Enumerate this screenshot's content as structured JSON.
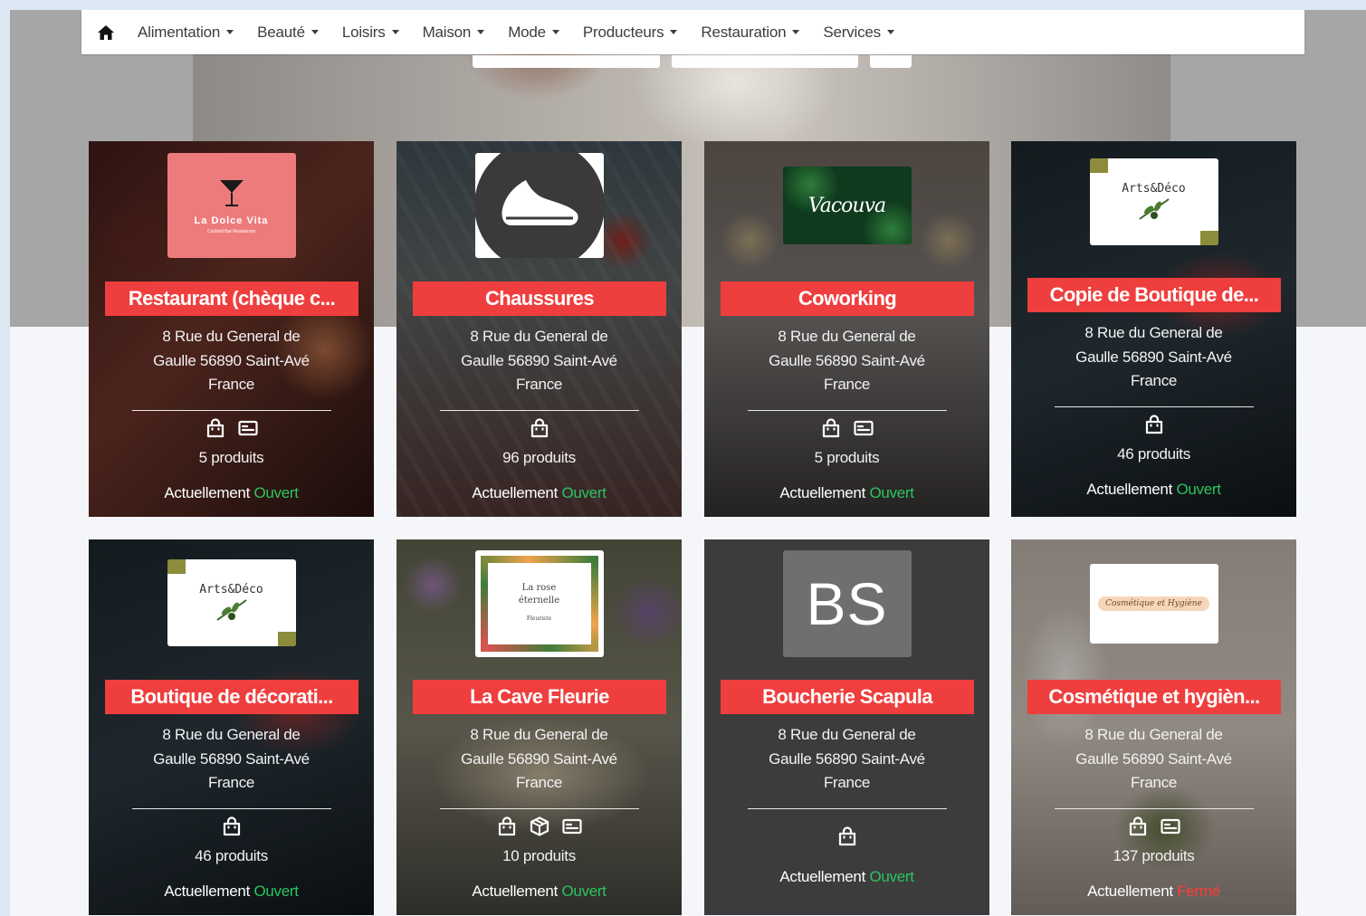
{
  "nav": {
    "items": [
      {
        "label": "Alimentation"
      },
      {
        "label": "Beauté"
      },
      {
        "label": "Loisirs"
      },
      {
        "label": "Maison"
      },
      {
        "label": "Mode"
      },
      {
        "label": "Producteurs"
      },
      {
        "label": "Restauration"
      },
      {
        "label": "Services"
      }
    ]
  },
  "colors": {
    "accent_red": "#ef3e3e",
    "open_green": "#2bc45f",
    "closed_red": "#ff3b3b"
  },
  "shops": [
    {
      "title": "Restaurant (chèque c...",
      "addr1": "8 Rue du General de",
      "addr2": "Gaulle 56890 Saint-Avé",
      "addr3": "France",
      "count": "5 produits",
      "status_prefix": "Actuellement",
      "status": "Ouvert",
      "logo_text": "La Dolce Vita",
      "logo_sub": "Cocktail Bar Restaurant",
      "icons": [
        "shopping-bag-icon",
        "voucher-card-icon"
      ]
    },
    {
      "title": "Chaussures",
      "addr1": "8 Rue du General de",
      "addr2": "Gaulle 56890 Saint-Avé",
      "addr3": "France",
      "count": "96 produits",
      "status_prefix": "Actuellement",
      "status": "Ouvert",
      "icons": [
        "shopping-bag-icon"
      ]
    },
    {
      "title": "Coworking",
      "addr1": "8 Rue du General de",
      "addr2": "Gaulle 56890 Saint-Avé",
      "addr3": "France",
      "count": "5 produits",
      "status_prefix": "Actuellement",
      "status": "Ouvert",
      "logo_text": "Vacouva",
      "icons": [
        "shopping-bag-icon",
        "voucher-card-icon"
      ]
    },
    {
      "title": "Copie de Boutique de...",
      "addr1": "8 Rue du General de",
      "addr2": "Gaulle 56890 Saint-Avé",
      "addr3": "France",
      "count": "46 produits",
      "status_prefix": "Actuellement",
      "status": "Ouvert",
      "logo_text": "Arts&Déco",
      "icons": [
        "shopping-bag-icon"
      ]
    },
    {
      "title": "Boutique de décorati...",
      "addr1": "8 Rue du General de",
      "addr2": "Gaulle 56890 Saint-Avé",
      "addr3": "France",
      "count": "46 produits",
      "status_prefix": "Actuellement",
      "status": "Ouvert",
      "logo_text": "Arts&Déco",
      "icons": [
        "shopping-bag-icon"
      ]
    },
    {
      "title": "La Cave Fleurie",
      "addr1": "8 Rue du General de",
      "addr2": "Gaulle 56890 Saint-Avé",
      "addr3": "France",
      "count": "10 produits",
      "status_prefix": "Actuellement",
      "status": "Ouvert",
      "logo_text": "La rose éternelle",
      "logo_sub": "Fleuriste",
      "icons": [
        "shopping-bag-icon",
        "package-box-icon",
        "voucher-card-icon"
      ]
    },
    {
      "title": "Boucherie Scapula",
      "addr1": "8 Rue du General de",
      "addr2": "Gaulle 56890 Saint-Avé",
      "addr3": "France",
      "count": "",
      "status_prefix": "Actuellement",
      "status": "Ouvert",
      "logo_text": "BS",
      "icons": [
        "shopping-bag-icon"
      ]
    },
    {
      "title": "Cosmétique et hygièn...",
      "addr1": "8 Rue du General de",
      "addr2": "Gaulle 56890 Saint-Avé",
      "addr3": "France",
      "count": "137 produits",
      "status_prefix": "Actuellement",
      "status": "Fermé",
      "logo_text": "Cosmétique et Hygiène",
      "icons": [
        "shopping-bag-icon",
        "voucher-card-icon"
      ]
    }
  ]
}
